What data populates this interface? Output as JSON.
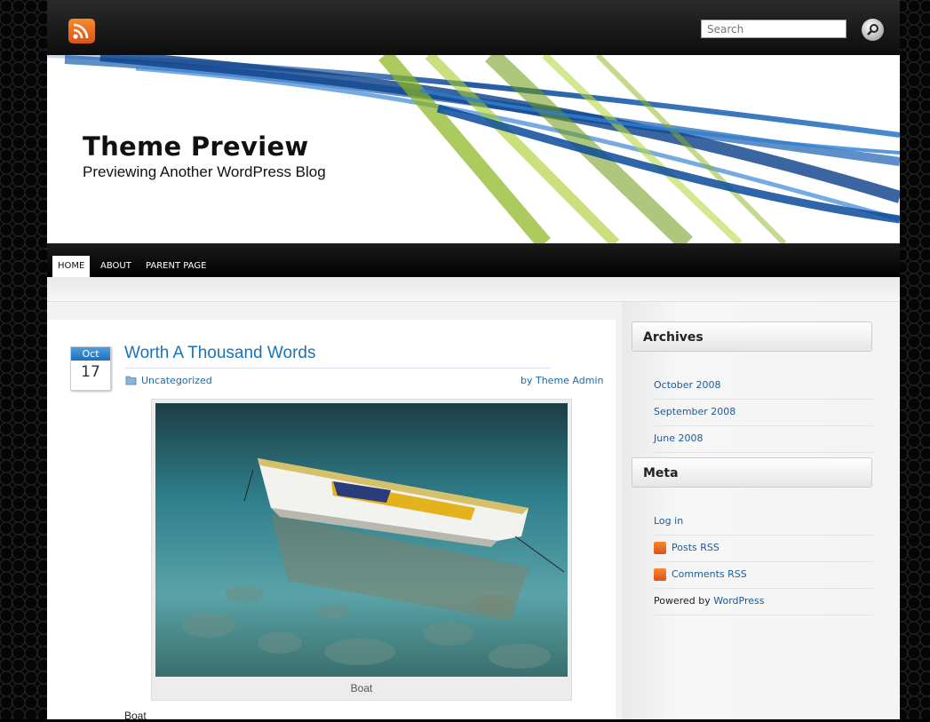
{
  "search": {
    "placeholder": "Search"
  },
  "site": {
    "title": "Theme Preview",
    "description": "Previewing Another WordPress Blog"
  },
  "nav": {
    "items": [
      {
        "label": "HOME",
        "active": true
      },
      {
        "label": "ABOUT",
        "active": false
      },
      {
        "label": "PARENT PAGE",
        "active": false
      }
    ]
  },
  "post": {
    "date_month": "Oct",
    "date_day": "17",
    "title": "Worth A Thousand Words",
    "category": "Uncategorized",
    "author_line": "by Theme Admin",
    "image_caption": "Boat",
    "text": "Boat"
  },
  "sidebar": {
    "archives": {
      "title": "Archives",
      "items": [
        "October 2008",
        "September 2008",
        "June 2008"
      ]
    },
    "meta": {
      "title": "Meta",
      "login": "Log in",
      "posts_rss": "Posts RSS",
      "comments_rss": "Comments RSS",
      "powered_prefix": "Powered by ",
      "powered_link": "WordPress"
    }
  },
  "colors": {
    "link": "#1a73b8",
    "rss": "#f07a22",
    "header_blue": "#0b4a9a",
    "header_green": "#8bb51c"
  }
}
